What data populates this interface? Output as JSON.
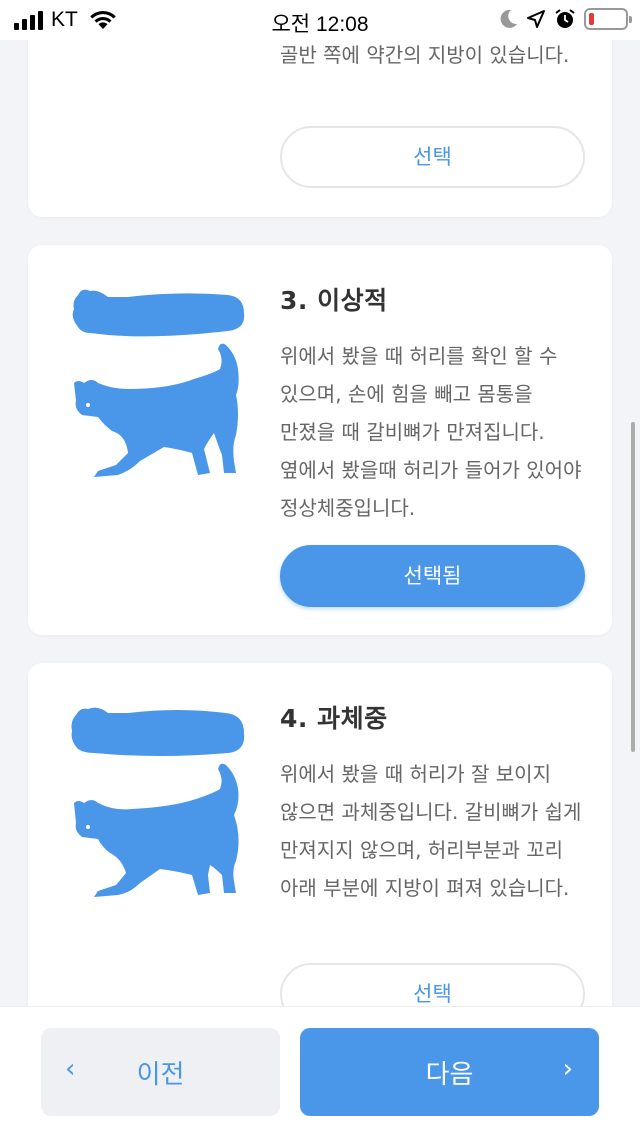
{
  "status_bar": {
    "carrier": "KT",
    "time": "오전 12:08",
    "icons": [
      "signal-icon",
      "wifi-icon",
      "moon-icon",
      "location-arrow-icon",
      "alarm-icon",
      "battery-icon"
    ],
    "battery_color": "#e53935",
    "battery_level": 0.15
  },
  "cards": [
    {
      "description_tail": "골반 쪽에 약간의 지방이 있습니다.",
      "button_label": "선택",
      "selected": false
    },
    {
      "title": "3. 이상적",
      "description": "위에서 봤을 때 허리를 확인 할 수 있으며, 손에 힘을 빼고 몸통을 만졌을 때 갈비뼈가 만져집니다. 옆에서 봤을때 허리가 들어가 있어야 정상체중입니다.",
      "button_label": "선택됨",
      "selected": true
    },
    {
      "title": "4. 과체중",
      "description": "위에서 봤을 때 허리가 잘 보이지 않으면 과체중입니다. 갈비뼈가 쉽게 만져지지 않으며, 허리부분과 꼬리 아래 부분에 지방이 펴져 있습니다.",
      "button_label": "선택",
      "selected": false
    }
  ],
  "navigation": {
    "prev_label": "이전",
    "next_label": "다음",
    "prev_icon": "chevron-left-icon",
    "next_icon": "chevron-right-icon"
  },
  "colors": {
    "accent": "#4a97ea",
    "background": "#f3f4f7",
    "card": "#ffffff"
  }
}
